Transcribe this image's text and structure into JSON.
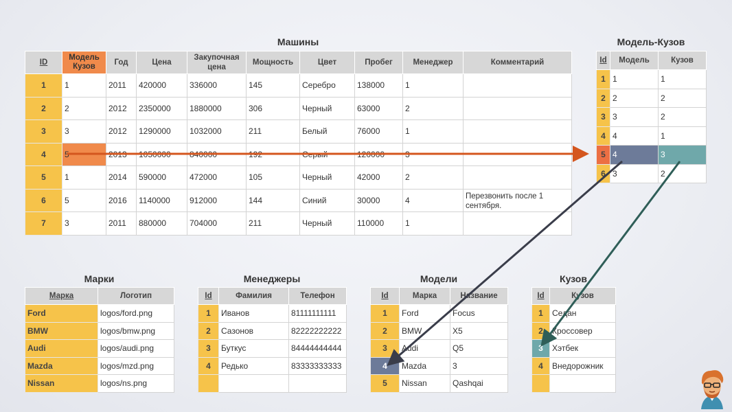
{
  "cars": {
    "title": "Машины",
    "headers": [
      "ID",
      "Модель Кузов",
      "Год",
      "Цена",
      "Закупочная цена",
      "Мощность",
      "Цвет",
      "Пробег",
      "Менеджер",
      "Комментарий"
    ],
    "rows": [
      [
        "1",
        "1",
        "2011",
        "420000",
        "336000",
        "145",
        "Серебро",
        "138000",
        "1",
        ""
      ],
      [
        "2",
        "2",
        "2012",
        "2350000",
        "1880000",
        "306",
        "Черный",
        "63000",
        "2",
        ""
      ],
      [
        "3",
        "3",
        "2012",
        "1290000",
        "1032000",
        "211",
        "Белый",
        "76000",
        "1",
        ""
      ],
      [
        "4",
        "5",
        "2013",
        "1050000",
        "840000",
        "192",
        "Серый",
        "120000",
        "3",
        ""
      ],
      [
        "5",
        "1",
        "2014",
        "590000",
        "472000",
        "105",
        "Черный",
        "42000",
        "2",
        ""
      ],
      [
        "6",
        "5",
        "2016",
        "1140000",
        "912000",
        "144",
        "Синий",
        "30000",
        "4",
        "Перезвонить после 1 сентября."
      ],
      [
        "7",
        "3",
        "2011",
        "880000",
        "704000",
        "211",
        "Черный",
        "110000",
        "1",
        ""
      ]
    ]
  },
  "model_body": {
    "title": "Модель-Кузов",
    "headers": [
      "Id",
      "Модель",
      "Кузов"
    ],
    "rows": [
      [
        "1",
        "1",
        "1"
      ],
      [
        "2",
        "2",
        "2"
      ],
      [
        "3",
        "3",
        "2"
      ],
      [
        "4",
        "4",
        "1"
      ],
      [
        "5",
        "4",
        "3"
      ],
      [
        "6",
        "3",
        "2"
      ]
    ]
  },
  "brands": {
    "title": "Марки",
    "headers": [
      "Марка",
      "Логотип"
    ],
    "rows": [
      [
        "Ford",
        "logos/ford.png"
      ],
      [
        "BMW",
        "logos/bmw.png"
      ],
      [
        "Audi",
        "logos/audi.png"
      ],
      [
        "Mazda",
        "logos/mzd.png"
      ],
      [
        "Nissan",
        "logos/ns.png"
      ]
    ]
  },
  "managers": {
    "title": "Менеджеры",
    "headers": [
      "Id",
      "Фамилия",
      "Телефон"
    ],
    "rows": [
      [
        "1",
        "Иванов",
        "81111111111"
      ],
      [
        "2",
        "Сазонов",
        "82222222222"
      ],
      [
        "3",
        "Буткус",
        "84444444444"
      ],
      [
        "4",
        "Редько",
        "83333333333"
      ],
      [
        "",
        "",
        ""
      ]
    ]
  },
  "models": {
    "title": "Модели",
    "headers": [
      "Id",
      "Марка",
      "Название"
    ],
    "rows": [
      [
        "1",
        "Ford",
        "Focus"
      ],
      [
        "2",
        "BMW",
        "X5"
      ],
      [
        "3",
        "Audi",
        "Q5"
      ],
      [
        "4",
        "Mazda",
        "3"
      ],
      [
        "5",
        "Nissan",
        "Qashqai"
      ]
    ]
  },
  "bodies": {
    "title": "Кузов",
    "headers": [
      "Id",
      "Кузов"
    ],
    "rows": [
      [
        "1",
        "Седан"
      ],
      [
        "2",
        "Кроссовер"
      ],
      [
        "3",
        "Хэтбек"
      ],
      [
        "4",
        "Внедорожник"
      ],
      [
        "",
        ""
      ]
    ]
  },
  "colors": {
    "key": "#f6c34a",
    "highlight_orange": "#f08a4b",
    "arrow_orange": "#d4561e",
    "slate": "#6d7b99",
    "teal": "#6fa8aa",
    "arrow_dark": "#3a3d4a",
    "arrow_teal": "#2f5e58"
  }
}
